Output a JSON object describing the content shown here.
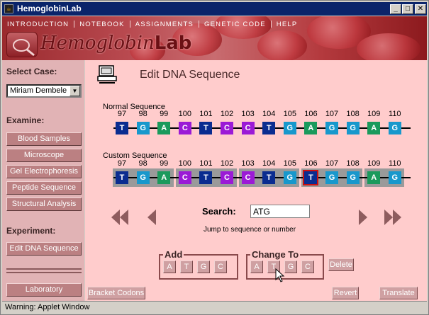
{
  "window": {
    "title": "HemoglobinLab",
    "app_icon": "applet-icon",
    "controls": {
      "minimize": "_",
      "maximize": "□",
      "close": "✕"
    }
  },
  "banner": {
    "menu": [
      "INTRODUCTION",
      "NOTEBOOK",
      "ASSIGNMENTS",
      "GENETIC CODE",
      "HELP"
    ],
    "logo_text_part1": "Hemoglobin",
    "logo_text_part2": "Lab"
  },
  "sidebar": {
    "select_case_heading": "Select Case:",
    "case_value": "Miriam Dembele",
    "examine_heading": "Examine:",
    "examine_buttons": [
      "Blood Samples",
      "Microscope",
      "Gel Electrophoresis",
      "Peptide Sequence",
      "Structural Analysis"
    ],
    "experiment_heading": "Experiment:",
    "experiment_buttons": [
      "Edit DNA Sequence"
    ],
    "laboratory_button": "Laboratory"
  },
  "main": {
    "title": "Edit DNA Sequence",
    "normal_label": "Normal Sequence",
    "custom_label": "Custom Sequence",
    "codon_numbers": [
      "97",
      "98",
      "99",
      "100",
      "101",
      "102",
      "103",
      "104",
      "105",
      "106",
      "107",
      "108",
      "109",
      "110"
    ],
    "normal_sequence": [
      "T",
      "G",
      "A",
      "C",
      "T",
      "C",
      "C",
      "T",
      "G",
      "A",
      "G",
      "G",
      "A",
      "G"
    ],
    "custom_sequence": [
      "T",
      "G",
      "A",
      "C",
      "T",
      "C",
      "C",
      "T",
      "G",
      "T",
      "G",
      "G",
      "A",
      "G"
    ],
    "selected_custom_index": 9,
    "search_label": "Search:",
    "search_value": "ATG",
    "search_hint": "Jump to sequence or number",
    "add_label": "Add",
    "change_label": "Change To",
    "nucleotide_buttons": [
      "A",
      "T",
      "G",
      "C"
    ],
    "delete_button": "Delete",
    "bracket_button": "Bracket Codons",
    "revert_button": "Revert",
    "translate_button": "Translate"
  },
  "colors": {
    "T": "#0a2c90",
    "G": "#1898cc",
    "A": "#1a9a5c",
    "C": "#9b1ad6"
  },
  "status": {
    "text": "Warning: Applet Window"
  }
}
